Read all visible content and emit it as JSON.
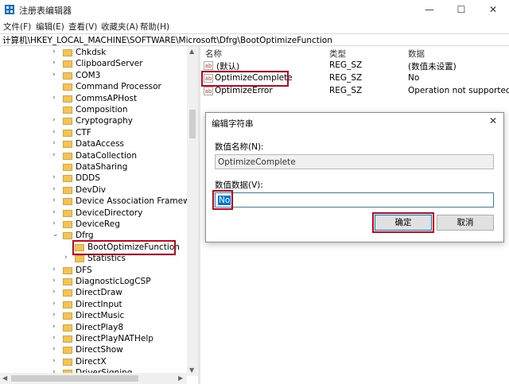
{
  "window": {
    "title": "注册表编辑器",
    "minimize_glyph": "—",
    "maximize_glyph": "☐",
    "close_glyph": "✕"
  },
  "menu": [
    "文件(F)",
    "编辑(E)",
    "查看(V)",
    "收藏夹(A)",
    "帮助(H)"
  ],
  "address": "计算机\\HKEY_LOCAL_MACHINE\\SOFTWARE\\Microsoft\\Dfrg\\BootOptimizeFunction",
  "tree": {
    "items": [
      {
        "label": "Chkdsk",
        "expander": ">"
      },
      {
        "label": "ClipboardServer",
        "expander": ">"
      },
      {
        "label": "COM3",
        "expander": ">"
      },
      {
        "label": "Command Processor",
        "expander": ""
      },
      {
        "label": "CommsAPHost",
        "expander": ">"
      },
      {
        "label": "Composition",
        "expander": ""
      },
      {
        "label": "Cryptography",
        "expander": ">"
      },
      {
        "label": "CTF",
        "expander": ">"
      },
      {
        "label": "DataAccess",
        "expander": ">"
      },
      {
        "label": "DataCollection",
        "expander": ">"
      },
      {
        "label": "DataSharing",
        "expander": ""
      },
      {
        "label": "DDDS",
        "expander": ">"
      },
      {
        "label": "DevDiv",
        "expander": ">"
      },
      {
        "label": "Device Association Framewor",
        "expander": ">"
      },
      {
        "label": "DeviceDirectory",
        "expander": ">"
      },
      {
        "label": "DeviceReg",
        "expander": ">"
      },
      {
        "label": "Dfrg",
        "expander": "v"
      },
      {
        "label": "BootOptimizeFunction",
        "expander": "",
        "child": true,
        "selected": true
      },
      {
        "label": "Statistics",
        "expander": ">",
        "child": true
      },
      {
        "label": "DFS",
        "expander": ">"
      },
      {
        "label": "DiagnosticLogCSP",
        "expander": ">"
      },
      {
        "label": "DirectDraw",
        "expander": ">"
      },
      {
        "label": "DirectInput",
        "expander": ">"
      },
      {
        "label": "DirectMusic",
        "expander": ">"
      },
      {
        "label": "DirectPlay8",
        "expander": ">"
      },
      {
        "label": "DirectPlayNATHelp",
        "expander": ">"
      },
      {
        "label": "DirectShow",
        "expander": ">"
      },
      {
        "label": "DirectX",
        "expander": ">"
      },
      {
        "label": "DriverSigning",
        "expander": ">"
      }
    ]
  },
  "list": {
    "headers": {
      "name": "名称",
      "type": "类型",
      "data": "数据"
    },
    "rows": [
      {
        "icon": "ab",
        "name": "(默认)",
        "type": "REG_SZ",
        "data": "(数值未设置)"
      },
      {
        "icon": "ab",
        "name": "OptimizeComplete",
        "type": "REG_SZ",
        "data": "No"
      },
      {
        "icon": "ab",
        "name": "OptimizeError",
        "type": "REG_SZ",
        "data": "Operation not supported"
      }
    ]
  },
  "dialog": {
    "title": "编辑字符串",
    "close_glyph": "✕",
    "name_label": "数值名称(N):",
    "name_value": "OptimizeComplete",
    "data_label": "数值数据(V):",
    "data_value": "No",
    "ok_label": "确定",
    "cancel_label": "取消"
  },
  "colors": {
    "highlight": "#d0021b",
    "selection": "#0078d7",
    "folder": "#f2c455"
  }
}
